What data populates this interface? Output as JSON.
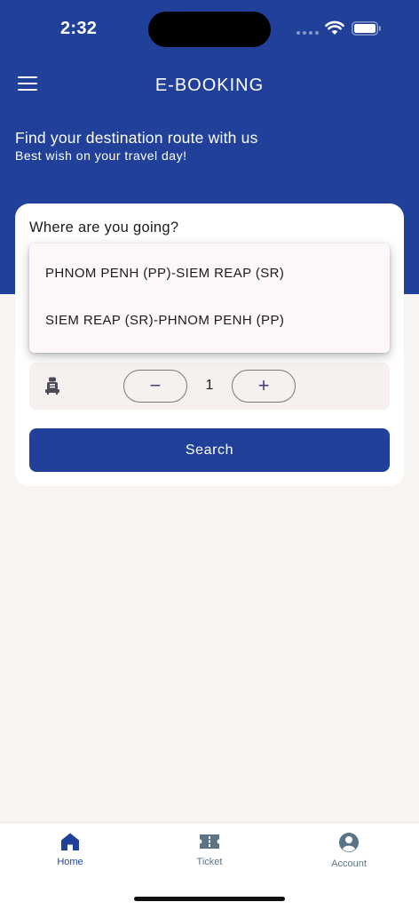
{
  "status_bar": {
    "time": "2:32"
  },
  "app_bar": {
    "title": "E-BOOKING"
  },
  "hero": {
    "title": "Find your destination route with us",
    "subtitle": "Best wish on your travel day!"
  },
  "booking_card": {
    "destination_label": "Where are you going?",
    "route_options": [
      "PHNOM PENH (PP)-SIEM REAP (SR)",
      "SIEM REAP (SR)-PHNOM PENH (PP)"
    ],
    "passengers": {
      "count": "1",
      "minus_symbol": "−",
      "plus_symbol": "+"
    },
    "search_label": "Search"
  },
  "bottom_nav": {
    "items": [
      {
        "label": "Home",
        "icon": "home-icon",
        "active": true
      },
      {
        "label": "Ticket",
        "icon": "ticket-icon",
        "active": false
      },
      {
        "label": "Account",
        "icon": "account-icon",
        "active": false
      }
    ]
  },
  "colors": {
    "primary": "#21409a",
    "background": "#f7f4f2",
    "nav_inactive": "#5b7384"
  }
}
